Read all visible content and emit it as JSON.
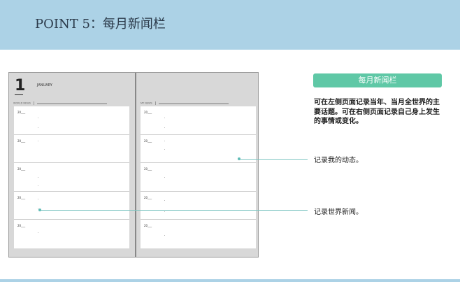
{
  "header": {
    "title": "POINT 5：每月新闻栏"
  },
  "notebook": {
    "day": "1",
    "month": "JANUARY",
    "left_section": "WORLD NEWS",
    "right_section": "MY NEWS",
    "row_label": "20___"
  },
  "panel": {
    "button": "每月新闻栏",
    "description": "可在左侧页面记录当年、当月全世界的主要话题。可在右侧页面记录自己身上发生的事情或变化。"
  },
  "callouts": {
    "my_news": "记录我的动态。",
    "world_news": "记录世界新闻。"
  },
  "colors": {
    "header": "#acd2e6",
    "accent": "#5fc8a6",
    "line": "#7fc6c2"
  }
}
